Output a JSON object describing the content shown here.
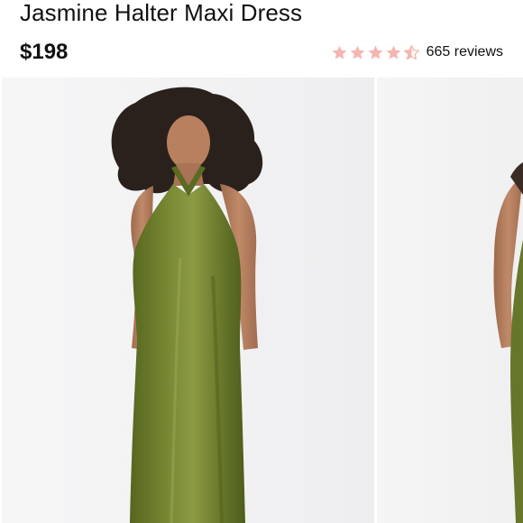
{
  "product": {
    "title": "Jasmine Halter Maxi Dress",
    "price": "$198",
    "rating": {
      "stars": 4.5,
      "max_stars": 5,
      "reviews_label": "665 reviews",
      "star_color": "#f4b6b0"
    }
  },
  "gallery": {
    "images": [
      {
        "name": "product-image-1",
        "subject": "woman wearing olive green satin halter maxi dress"
      },
      {
        "name": "product-image-2",
        "subject": "partial view of next product photo"
      }
    ],
    "dress_color": "#6b7a2c"
  }
}
